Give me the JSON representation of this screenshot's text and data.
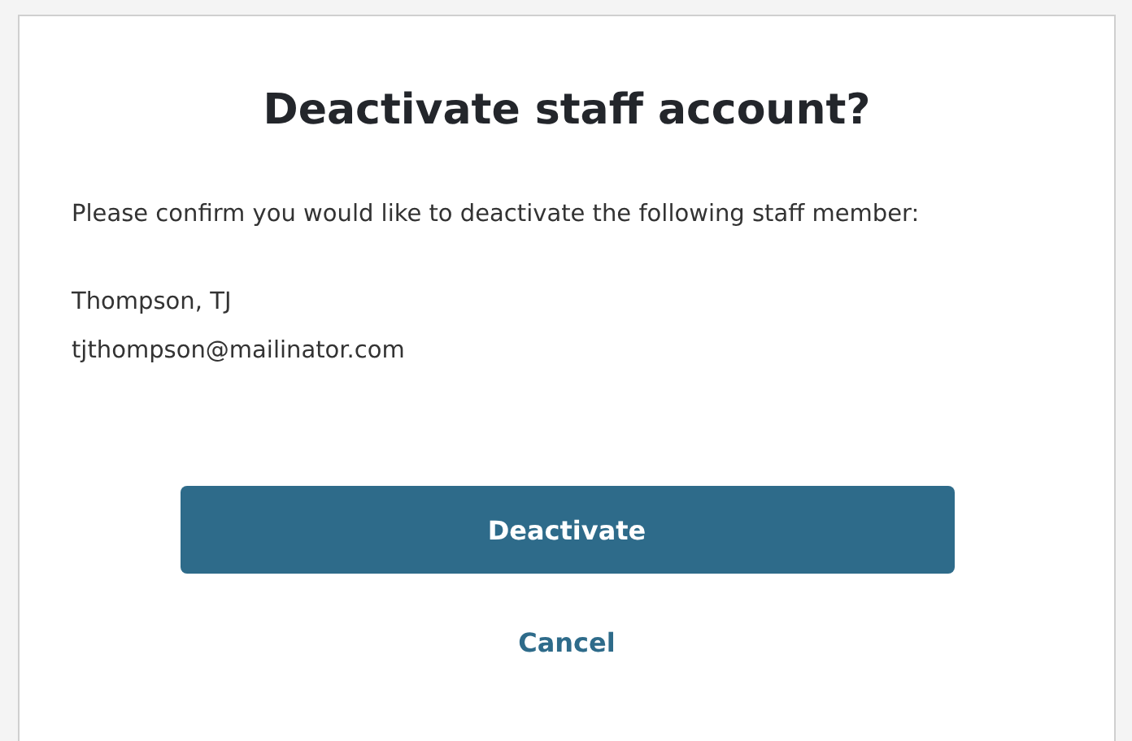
{
  "dialog": {
    "title": "Deactivate staff account?",
    "message": "Please confirm you would like to deactivate the following staff member:",
    "staff": {
      "name": "Thompson, TJ",
      "email": "tjthompson@mailinator.com"
    },
    "primary_button": "Deactivate",
    "cancel_link": "Cancel"
  }
}
